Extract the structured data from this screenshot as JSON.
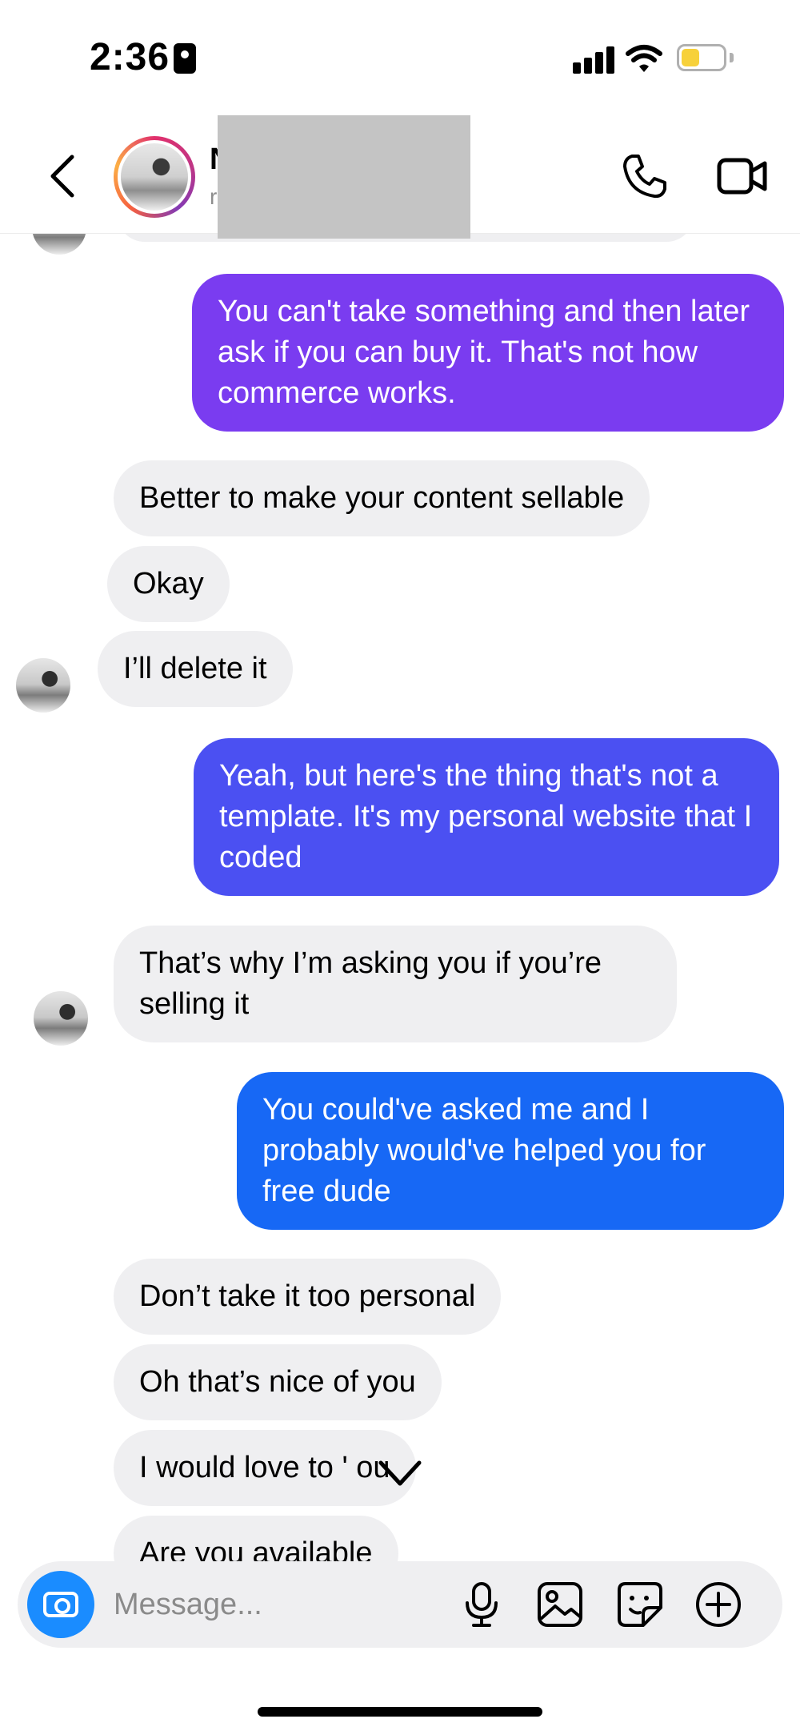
{
  "status_bar": {
    "time": "2:36"
  },
  "header": {
    "contact_name": "N",
    "contact_username": "r"
  },
  "messages": [
    {
      "side": "out",
      "text": "You can't take something and then later ask if you can buy it. That's not how commerce works.",
      "color": "#7a3cf0"
    },
    {
      "side": "in",
      "text": "Better to make your content sellable"
    },
    {
      "side": "in",
      "text": "Okay"
    },
    {
      "side": "in",
      "text": "I’ll delete it"
    },
    {
      "side": "out",
      "text": "Yeah, but here's the thing that's not a template. It's my personal website that I coded",
      "color": "#4b50f2"
    },
    {
      "side": "in",
      "text": "That’s why I’m asking you if you’re selling it"
    },
    {
      "side": "out",
      "text": "You could've asked me and I probably would've helped you for free dude",
      "color": "#1768f5"
    },
    {
      "side": "in",
      "text": "Don’t take it too personal"
    },
    {
      "side": "in",
      "text": "Oh that’s nice of you"
    },
    {
      "side": "in",
      "text": "I would love to ' ou"
    },
    {
      "side": "in",
      "text": "Are you available"
    }
  ],
  "composer": {
    "placeholder": "Message..."
  },
  "icons": {
    "back": "chevron-left-icon",
    "call": "phone-icon",
    "video": "video-camera-icon",
    "camera": "camera-icon",
    "mic": "microphone-icon",
    "gallery": "image-icon",
    "sticker": "sticker-icon",
    "more": "plus-circle-icon",
    "scroll": "chevron-down-icon"
  }
}
